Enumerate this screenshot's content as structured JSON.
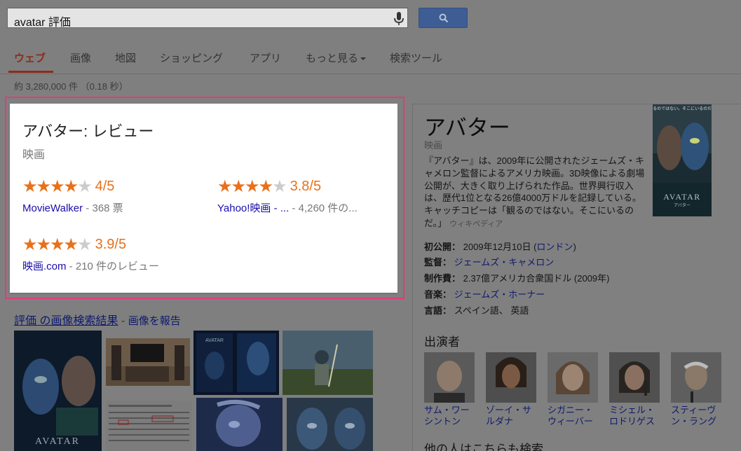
{
  "search": {
    "query": "avatar 評価"
  },
  "nav": {
    "tabs": [
      {
        "label": "ウェブ"
      },
      {
        "label": "画像"
      },
      {
        "label": "地図"
      },
      {
        "label": "ショッピング"
      },
      {
        "label": "アプリ"
      },
      {
        "label": "もっと見る"
      },
      {
        "label": "検索ツール"
      }
    ]
  },
  "stats": "約 3,280,000 件 （0.18 秒）",
  "review_card": {
    "title": "アバター: レビュー",
    "subtitle": "映画",
    "reviews": [
      {
        "stars": 4,
        "score": "4/5",
        "source": "MovieWalker",
        "count": " - 368 票"
      },
      {
        "stars": 4,
        "score": "3.8/5",
        "source": "Yahoo!映画 - ...",
        "count": " - 4,260 件の..."
      },
      {
        "stars": 4,
        "score": "3.9/5",
        "source": "映画.com",
        "count": " - 210 件のレビュー"
      }
    ]
  },
  "images": {
    "link_term": "評価",
    "link_rest": " の画像検索結果",
    "separator": " - ",
    "report": "画像を報告"
  },
  "knowledge": {
    "title": "アバター",
    "subtitle": "映画",
    "description": "『アバター』は、2009年に公開されたジェームズ・キャメロン監督によるアメリカ映画。3D映像による劇場公開が、大きく取り上げられた作品。世界興行収入は、歴代1位となる26億4000万ドルを記録している。キャッチコピーは「観るのではない。そこにいるのだ。」",
    "wiki": "ウィキペディア",
    "poster_caption": "観るのではない。そこにいるのだ。",
    "poster_title": "AVATAR",
    "poster_subtitle": "アバター",
    "facts": {
      "release_label": "初公開：",
      "release_value": "2009年12月10日 (",
      "release_link": "ロンドン",
      "release_end": ")",
      "director_label": "監督：",
      "director_value": "ジェームズ・キャメロン",
      "budget_label": "制作費：",
      "budget_value": "2.37億アメリカ合衆国ドル (2009年)",
      "music_label": "音楽：",
      "music_value": "ジェームズ・ホーナー",
      "language_label": "言語：",
      "language_value": "スペイン語、 英語"
    },
    "cast_heading": "出演者",
    "cast": [
      {
        "name": "サム・ワーシントン"
      },
      {
        "name": "ゾーイ・サルダナ"
      },
      {
        "name": "シガニー・ウィーバー"
      },
      {
        "name": "ミシェル・ロドリゲス"
      },
      {
        "name": "スティーヴン・ラング"
      }
    ],
    "more_heading": "他の人はこちらも検索"
  },
  "colors": {
    "accent_red": "#dd4b39",
    "star_orange": "#e7711b",
    "link_blue": "#1a0dab",
    "highlight_pink": "#e23b7c"
  }
}
